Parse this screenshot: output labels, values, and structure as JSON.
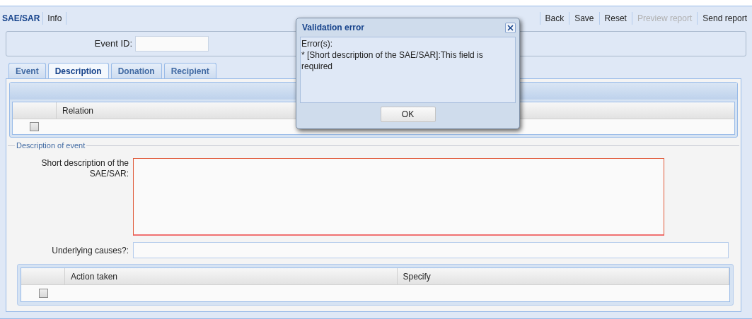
{
  "toolbar": {
    "title": "SAE/SAR",
    "left_buttons": [
      {
        "label": "Info",
        "disabled": false
      }
    ],
    "right_buttons": [
      {
        "label": "Back",
        "disabled": false
      },
      {
        "label": "Save",
        "disabled": false
      },
      {
        "label": "Reset",
        "disabled": false
      },
      {
        "label": "Preview report",
        "disabled": true
      },
      {
        "label": "Send report",
        "disabled": false
      }
    ]
  },
  "event_id": {
    "label": "Event ID:"
  },
  "tabs": [
    {
      "label": "Event",
      "selected": false
    },
    {
      "label": "Description",
      "selected": true
    },
    {
      "label": "Donation",
      "selected": false
    },
    {
      "label": "Recipient",
      "selected": false
    }
  ],
  "relation_grid": {
    "columns": [
      "Relation"
    ],
    "rows": [
      {
        "checked": false
      }
    ]
  },
  "fieldset": {
    "legend": "Description of event",
    "short_description": {
      "label": "Short description of the SAE/SAR:",
      "invalid": true
    },
    "underlying_causes": {
      "label": "Underlying causes?:"
    },
    "action_grid": {
      "columns": [
        "Action taken",
        "Specify"
      ],
      "rows": [
        {
          "checked": false
        }
      ]
    }
  },
  "dialog": {
    "title": "Validation error",
    "lines": [
      "Error(s):",
      "* [Short description of the SAE/SAR]:This field is required"
    ],
    "button": "OK"
  }
}
